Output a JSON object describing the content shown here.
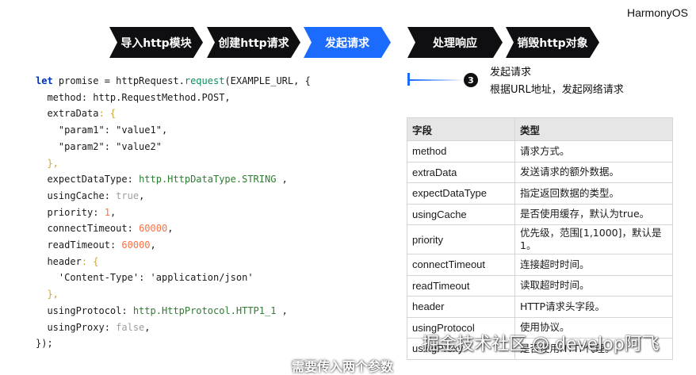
{
  "brand": "HarmonyOS",
  "steps": [
    {
      "label": "导入http模块",
      "active": false
    },
    {
      "label": "创建http请求",
      "active": false
    },
    {
      "label": "发起请求",
      "active": true
    },
    {
      "label": "处理响应",
      "active": false
    },
    {
      "label": "销毁http对象",
      "active": false
    }
  ],
  "timeline": {
    "number": "3",
    "title": "发起请求",
    "desc": "根据URL地址，发起网络请求"
  },
  "code": {
    "line1": {
      "kw": "let",
      "a": " promise = httpRequest.",
      "fn": "request",
      "b": "(EXAMPLE_URL, {"
    },
    "method": {
      "k": "method",
      "v": ": http.RequestMethod.POST,"
    },
    "extraData": {
      "k": "extraData",
      "v": ": {"
    },
    "param1": {
      "k": "\"param1\"",
      "v": "\"value1\""
    },
    "param2": {
      "k": "\"param2\"",
      "v": "\"value2\""
    },
    "close1": "},",
    "expectDataType": {
      "k": "expectDataType",
      "v": "http.HttpDataType.STRING"
    },
    "usingCache": {
      "k": "usingCache",
      "v": "true"
    },
    "priority": {
      "k": "priority",
      "v": "1"
    },
    "connectTimeout": {
      "k": "connectTimeout",
      "v": "60000"
    },
    "readTimeout": {
      "k": "readTimeout",
      "v": "60000"
    },
    "header": {
      "k": "header",
      "v": ": {"
    },
    "contentType": {
      "k": "'Content-Type'",
      "v": "'application/json'"
    },
    "close2": "},",
    "usingProtocol": {
      "k": "usingProtocol",
      "v": "http.HttpProtocol.HTTP1_1"
    },
    "usingProxy": {
      "k": "usingProxy",
      "v": "false"
    },
    "end": "});"
  },
  "table": {
    "headers": [
      "字段",
      "类型"
    ],
    "rows": [
      [
        "method",
        "请求方式。"
      ],
      [
        "extraData",
        "发送请求的额外数据。"
      ],
      [
        "expectDataType",
        "指定返回数据的类型。"
      ],
      [
        "usingCache",
        "是否使用缓存，默认为true。"
      ],
      [
        "priority",
        "优先级，范围[1,1000]，默认是1。"
      ],
      [
        "connectTimeout",
        "连接超时时间。"
      ],
      [
        "readTimeout",
        "读取超时时间。"
      ],
      [
        "header",
        "HTTP请求头字段。"
      ],
      [
        "usingProtocol",
        "使用协议。"
      ],
      [
        "usingProxy",
        "是否使用HTTP代理。"
      ]
    ]
  },
  "watermark": "掘金技术社区 @ develop阿飞",
  "subtitle": "需要传入两个参数"
}
